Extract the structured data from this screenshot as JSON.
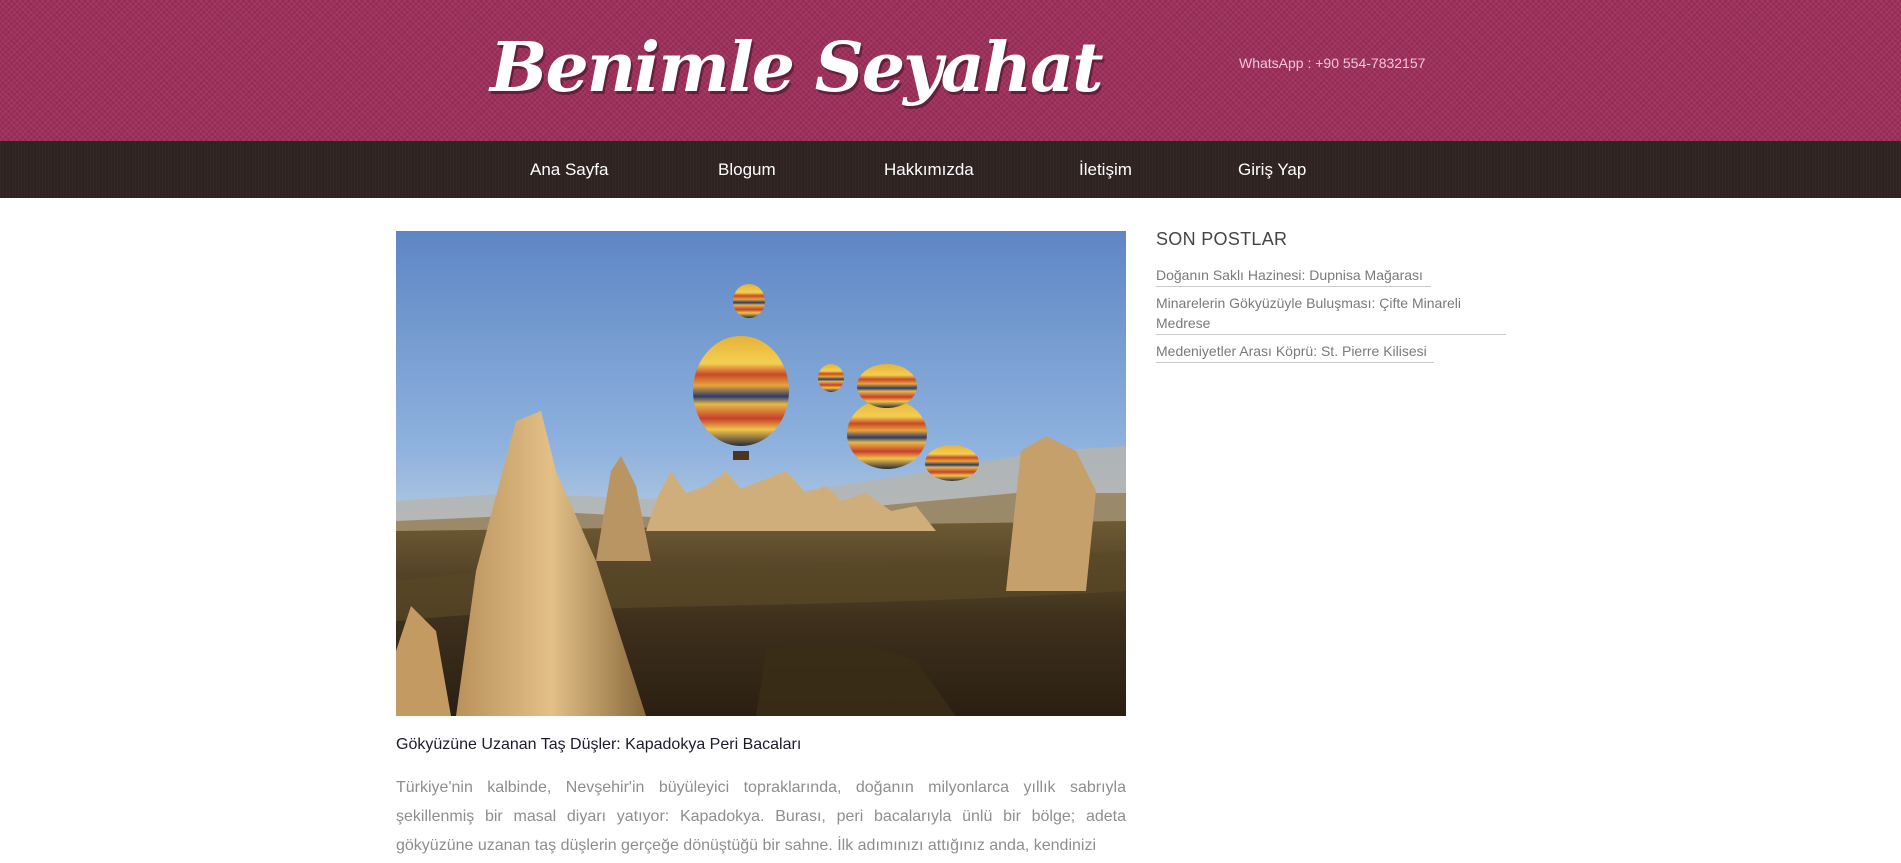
{
  "header": {
    "logo_text": "Benimle Seyahat",
    "whatsapp": "WhatsApp : +90 554-7832157",
    "bg_color": "#9c2d59"
  },
  "nav": {
    "bg_color": "#2f2322",
    "items": [
      {
        "label": "Ana Sayfa"
      },
      {
        "label": "Blogum"
      },
      {
        "label": "Hakkımızda"
      },
      {
        "label": "İletişim"
      },
      {
        "label": "Giriş Yap"
      }
    ]
  },
  "main": {
    "post": {
      "image_subject": "cappadocia-hot-air-balloons",
      "title": "Gökyüzüne Uzanan Taş Düşler: Kapadokya Peri Bacaları",
      "excerpt": "Türkiye'nin kalbinde, Nevşehir'in büyüleyici topraklarında, doğanın milyonlarca yıllık sabrıyla şekillenmiş bir masal diyarı yatıyor: Kapadokya. Burası, peri bacalarıyla ünlü bir bölge; adeta gökyüzüne uzanan taş düşlerin gerçeğe dönüştüğü bir sahne. İlk adımınızı attığınız anda, kendinizi"
    }
  },
  "sidebar": {
    "title": "SON POSTLAR",
    "posts": [
      {
        "label": "Doğanın Saklı Hazinesi: Dupnisa Mağarası"
      },
      {
        "label": "Minarelerin Gökyüzüyle Buluşması: Çifte Minareli Medrese"
      },
      {
        "label": "Medeniyetler Arası Köprü: St. Pierre Kilisesi"
      }
    ]
  }
}
